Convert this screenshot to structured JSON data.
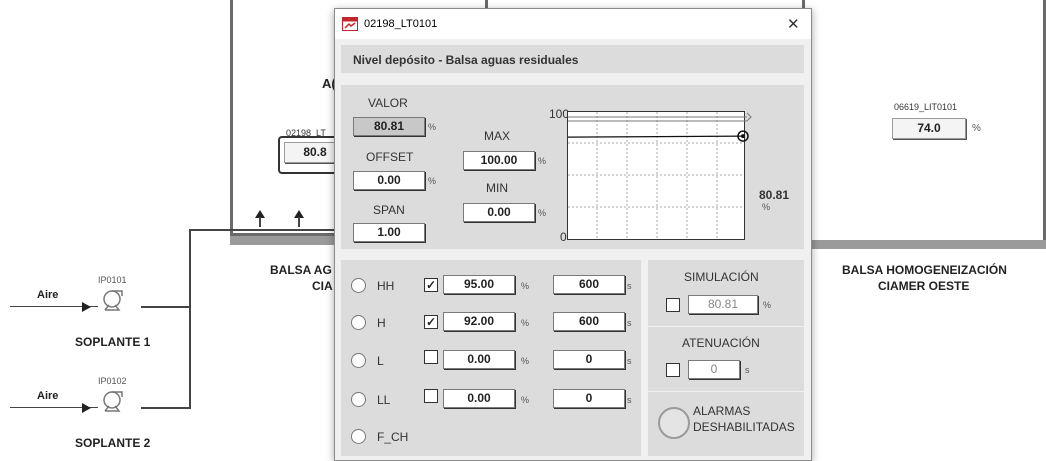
{
  "background": {
    "tank_left": {
      "label_partial": "A(",
      "badge_id": "02198_LT",
      "value_partial": "80.8"
    },
    "tank_right": {
      "badge_id": "06619_LIT0101",
      "value": "74.0",
      "unit": "%"
    },
    "caption_left": [
      "BALSA AG",
      "CIA"
    ],
    "caption_right": [
      "BALSA HOMOGENEIZACIÓN",
      "CIAMER OESTE"
    ],
    "pump1": {
      "tag": "IP0101",
      "name": "SOPLANTE 1",
      "air": "Aire"
    },
    "pump2": {
      "tag": "IP0102",
      "name": "SOPLANTE 2",
      "air": "Aire"
    }
  },
  "dialog": {
    "title": "02198_LT0101",
    "close": "✕",
    "header": "Nivel depósito - Balsa aguas residuales",
    "valor_label": "VALOR",
    "valor": "80.81",
    "offset_label": "OFFSET",
    "offset": "0.00",
    "span_label": "SPAN",
    "span": "1.00",
    "max_label": "MAX",
    "max": "100.00",
    "min_label": "MIN",
    "min": "0.00",
    "pct": "%",
    "s": "s",
    "trend": {
      "y_top": "100",
      "y_bottom": "0",
      "current": "80.81",
      "unit": "%",
      "level": 0.8081
    },
    "alarms": [
      {
        "name": "HH",
        "checked": true,
        "value": "95.00",
        "delay": "600"
      },
      {
        "name": "H",
        "checked": true,
        "value": "92.00",
        "delay": "600"
      },
      {
        "name": "L",
        "checked": false,
        "value": "0.00",
        "delay": "0"
      },
      {
        "name": "LL",
        "checked": false,
        "value": "0.00",
        "delay": "0"
      },
      {
        "name": "F_CH"
      }
    ],
    "simulacion_label": "SIMULACIÓN",
    "simulacion_value": "80.81",
    "atenuacion_label": "ATENUACIÓN",
    "atenuacion_value": "0",
    "alarmas_label_1": "ALARMAS",
    "alarmas_label_2": "DESHABILITADAS",
    "check_mark": "✓"
  }
}
